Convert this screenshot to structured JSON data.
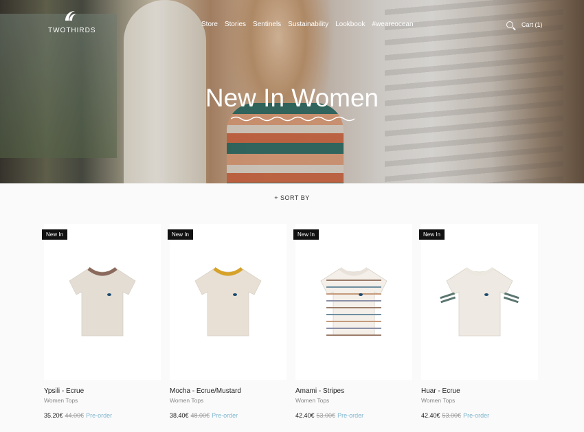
{
  "brand": {
    "name": "TWOTHIRDS"
  },
  "nav": {
    "items": [
      "Store",
      "Stories",
      "Sentinels",
      "Sustainability",
      "Lookbook",
      "#weareocean"
    ]
  },
  "cart": {
    "label": "Cart (1)"
  },
  "hero": {
    "title": "New In Women"
  },
  "sort": {
    "label": "+ SORT BY"
  },
  "products": [
    {
      "badge": "New In",
      "name": "Ypsili - Ecrue",
      "category": "Women Tops",
      "price": "35.20€",
      "old_price": "44.00€",
      "preorder": "Pre-order",
      "collar": "#8a6a5c",
      "body": "#e3ddd4",
      "stripes": ""
    },
    {
      "badge": "New In",
      "name": "Mocha - Ecrue/Mustard",
      "category": "Women Tops",
      "price": "38.40€",
      "old_price": "48.00€",
      "preorder": "Pre-order",
      "collar": "#d6a22a",
      "body": "#e8e0d5",
      "stripes": ""
    },
    {
      "badge": "New In",
      "name": "Amami - Stripes",
      "category": "Women Tops",
      "price": "42.40€",
      "old_price": "53.00€",
      "preorder": "Pre-order",
      "collar": "#e8e2da",
      "body": "#f4efe9",
      "stripes": "stripes"
    },
    {
      "badge": "New In",
      "name": "Huar - Ecrue",
      "category": "Women Tops",
      "price": "42.40€",
      "old_price": "53.00€",
      "preorder": "Pre-order",
      "collar": "#ece7df",
      "body": "#eeeae3",
      "stripes": "sleeves"
    }
  ]
}
